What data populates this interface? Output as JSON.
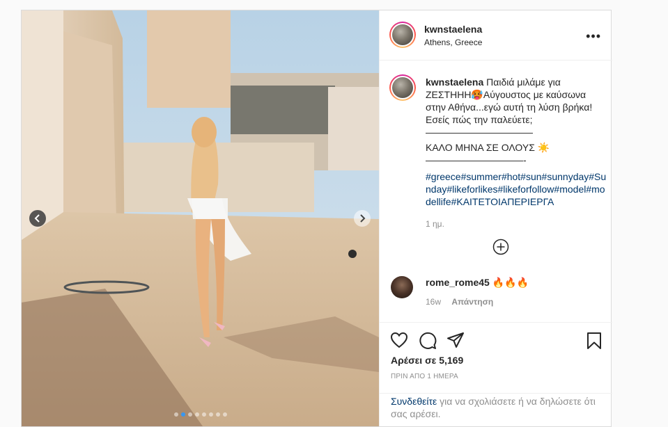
{
  "post": {
    "username": "kwnstaelena",
    "location": "Athens, Greece",
    "caption_lines": [
      "Παιδιά μιλάμε για ΖΕΣΤΗΗΗ🥵Αύγουστος με καύσωνα στην Αθήνα...εγώ αυτή τη λύση βρήκα! Εσείς πώς την παλεύετε;",
      "———————————",
      "ΚΑΛΟ ΜΗΝΑ ΣΕ ΟΛΟΥΣ ☀️",
      "——————————-"
    ],
    "hashtags": "#greece#summer#hot#sun#sunnyday#Sunday#likeforlikes#likeforfollow#model#modellife#ΚΑΙΤΕΤΟΙΑΠΕΡΙΕΡΓΑ",
    "caption_age": "1 ημ.",
    "likes": "Αρέσει σε 5,169",
    "posted_time": "ΠΡΙΝ ΑΠΟ 1 ΗΜΕΡΑ"
  },
  "comment": {
    "username": "rome_rome45",
    "text": "🔥🔥🔥",
    "age": "16w",
    "reply_label": "Απάντηση"
  },
  "login_prompt": {
    "link": "Συνδεθείτε",
    "text": " για να σχολιάσετε ή να δηλώσετε ότι σας αρέσει."
  },
  "carousel": {
    "count": 8,
    "active_index": 1
  },
  "icons": {
    "more": "more-options-icon",
    "add_comments": "plus-circle-icon",
    "like": "heart-icon",
    "comment": "comment-bubble-icon",
    "share": "paper-plane-icon",
    "save": "bookmark-icon",
    "prev": "chevron-left-icon",
    "next": "chevron-right-icon"
  },
  "colors": {
    "link": "#00376b",
    "active_dot": "#3897f0",
    "muted": "#8e8e8e"
  }
}
